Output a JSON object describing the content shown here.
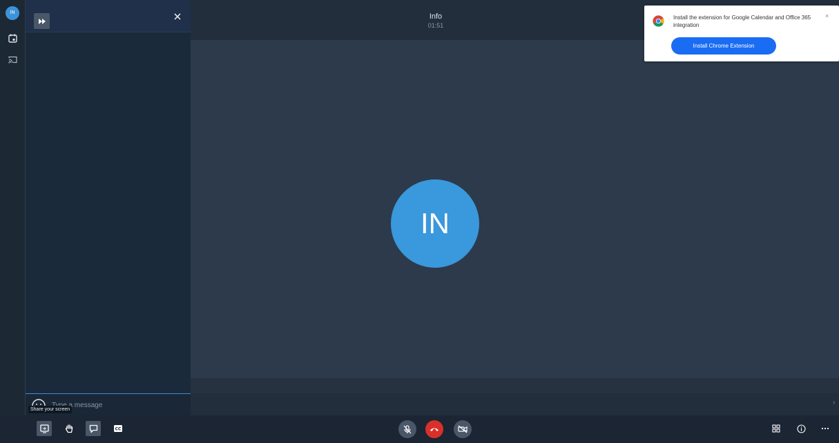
{
  "user": {
    "initials": "IN"
  },
  "meeting": {
    "title": "Info",
    "timer": "01:51"
  },
  "chat": {
    "placeholder": "Type a message",
    "tooltip": "Share your screen"
  },
  "notification": {
    "text": "Install the extension for Google Calendar and Office 365 integration",
    "button_label": "Install Chrome Extension",
    "close_symbol": "×"
  },
  "colors": {
    "avatar": "#3a98dc",
    "hangup": "#d9302a",
    "install_button": "#1a6cf3"
  },
  "icons": {
    "rail": [
      "calendar-icon",
      "cast-icon",
      "settings-icon"
    ],
    "toolbar_left": [
      "share-screen-icon",
      "raise-hand-icon",
      "chat-icon",
      "closed-captions-icon"
    ],
    "toolbar_center": [
      "mic-muted-icon",
      "hang-up-icon",
      "camera-off-icon"
    ],
    "toolbar_right": [
      "tile-view-icon",
      "info-icon",
      "more-options-icon"
    ]
  }
}
